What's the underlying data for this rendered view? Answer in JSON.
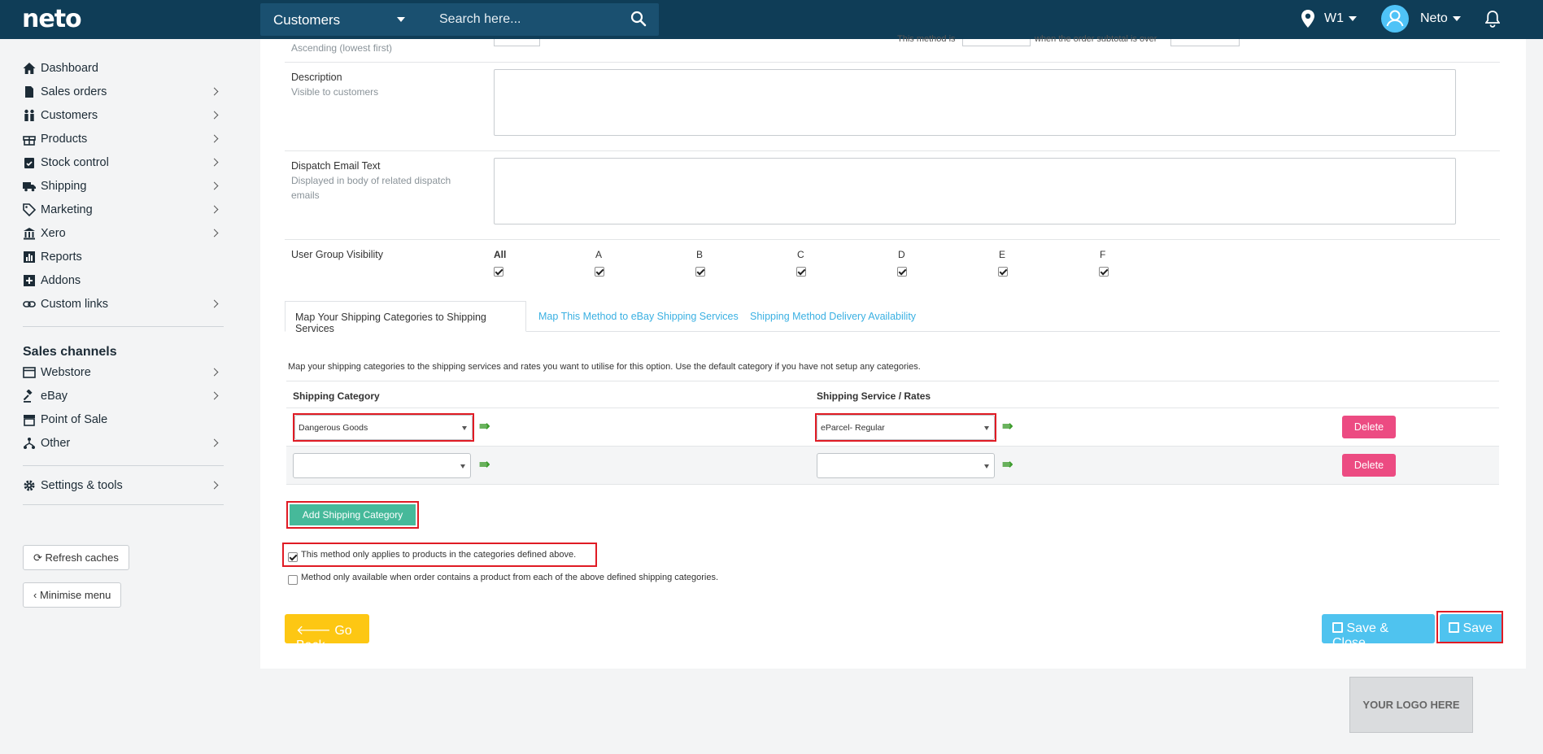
{
  "header": {
    "logo": "neto",
    "search_scope": "Customers",
    "search_placeholder": "Search here...",
    "location": "W1",
    "user": "Neto"
  },
  "sidebar": {
    "items": [
      {
        "label": "Dashboard",
        "icon": "home-icon"
      },
      {
        "label": "Sales orders",
        "icon": "file-icon"
      },
      {
        "label": "Customers",
        "icon": "users-icon"
      },
      {
        "label": "Products",
        "icon": "gift-icon"
      },
      {
        "label": "Stock control",
        "icon": "clipboard-check-icon"
      },
      {
        "label": "Shipping",
        "icon": "truck-icon"
      },
      {
        "label": "Marketing",
        "icon": "tags-icon"
      },
      {
        "label": "Xero",
        "icon": "bank-icon"
      },
      {
        "label": "Reports",
        "icon": "bar-chart-icon"
      },
      {
        "label": "Addons",
        "icon": "plus-square-icon"
      },
      {
        "label": "Custom links",
        "icon": "link-icon"
      }
    ],
    "channels_heading": "Sales channels",
    "channels": [
      {
        "label": "Webstore",
        "icon": "webstore-icon"
      },
      {
        "label": "eBay",
        "icon": "gavel-icon"
      },
      {
        "label": "Point of Sale",
        "icon": "store-icon"
      },
      {
        "label": "Other",
        "icon": "sitemap-icon"
      }
    ],
    "settings": "Settings & tools",
    "refresh_caches": "Refresh caches",
    "minimise_menu": "Minimise menu"
  },
  "form": {
    "sort_help": "Ascending (lowest first)",
    "rule_text_1": "This method is",
    "rule_text_2": "when the order subtotal is over",
    "description": {
      "label": "Description",
      "help": "Visible to customers",
      "value": ""
    },
    "dispatch": {
      "label": "Dispatch Email Text",
      "help": "Displayed in body of related dispatch emails",
      "value": ""
    },
    "user_group_visibility": {
      "label": "User Group Visibility",
      "groups": [
        {
          "name": "All",
          "checked": true
        },
        {
          "name": "A",
          "checked": true
        },
        {
          "name": "B",
          "checked": true
        },
        {
          "name": "C",
          "checked": true
        },
        {
          "name": "D",
          "checked": true
        },
        {
          "name": "E",
          "checked": true
        },
        {
          "name": "F",
          "checked": true
        }
      ]
    }
  },
  "tabs": [
    {
      "label": "Map Your Shipping Categories to Shipping Services",
      "active": true
    },
    {
      "label": "Map This Method to eBay Shipping Services",
      "active": false
    },
    {
      "label": "Shipping Method Delivery Availability",
      "active": false
    }
  ],
  "mapping": {
    "intro": "Map your shipping categories to the shipping services and rates you want to utilise for this option. Use the default category if you have not setup any categories.",
    "col_category": "Shipping Category",
    "col_service": "Shipping Service / Rates",
    "rows": [
      {
        "category": "Dangerous Goods",
        "service": "eParcel- Regular",
        "delete": "Delete"
      },
      {
        "category": "",
        "service": "",
        "delete": "Delete"
      }
    ],
    "arrow": "⇛",
    "add_button": "Add Shipping Category",
    "check_1": {
      "label": "This method only applies to products in the categories defined above.",
      "checked": true
    },
    "check_2": {
      "label": "Method only available when order contains a product from each of the above defined shipping categories.",
      "checked": false
    }
  },
  "actions": {
    "go_back": "Go Back",
    "save_close": "Save & Close",
    "save": "Save"
  },
  "footer_logo": "YOUR LOGO HERE",
  "colors": {
    "topbar": "#0f3d57",
    "delete": "#ec4b82",
    "add": "#46b99a",
    "save": "#4fc3ef",
    "back": "#fdc713",
    "highlight": "#e01b24"
  }
}
